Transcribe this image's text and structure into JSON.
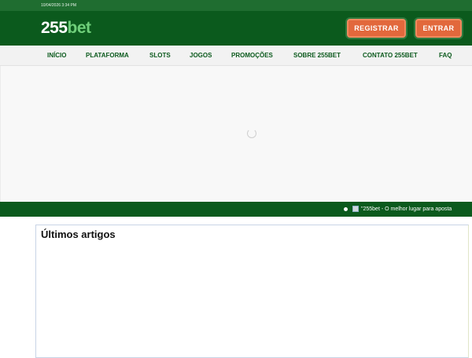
{
  "topbar": {
    "datetime": "10/04/2026 3:34 PM"
  },
  "header": {
    "logo": {
      "num": "255",
      "bet": "bet"
    },
    "buttons": {
      "registrar": "REGISTRAR",
      "entrar": "ENTRAR"
    },
    "colors": {
      "background": "#0b5a1d",
      "button": "#e2683c",
      "logo_accent": "#6fcf7a"
    }
  },
  "nav": {
    "items": [
      "INÍCIO",
      "PLATAFORMA",
      "SLOTS",
      "JOGOS",
      "PROMOÇÕES",
      "SOBRE 255BET",
      "CONTATO 255BET",
      "FAQ"
    ]
  },
  "ticker": {
    "text": "\"255bet - O melhor lugar para aposta"
  },
  "articles": {
    "title": "Últimos artigos"
  },
  "icons": {
    "loading": "loading-spinner-icon",
    "ticker_badge": "flag-icon"
  }
}
